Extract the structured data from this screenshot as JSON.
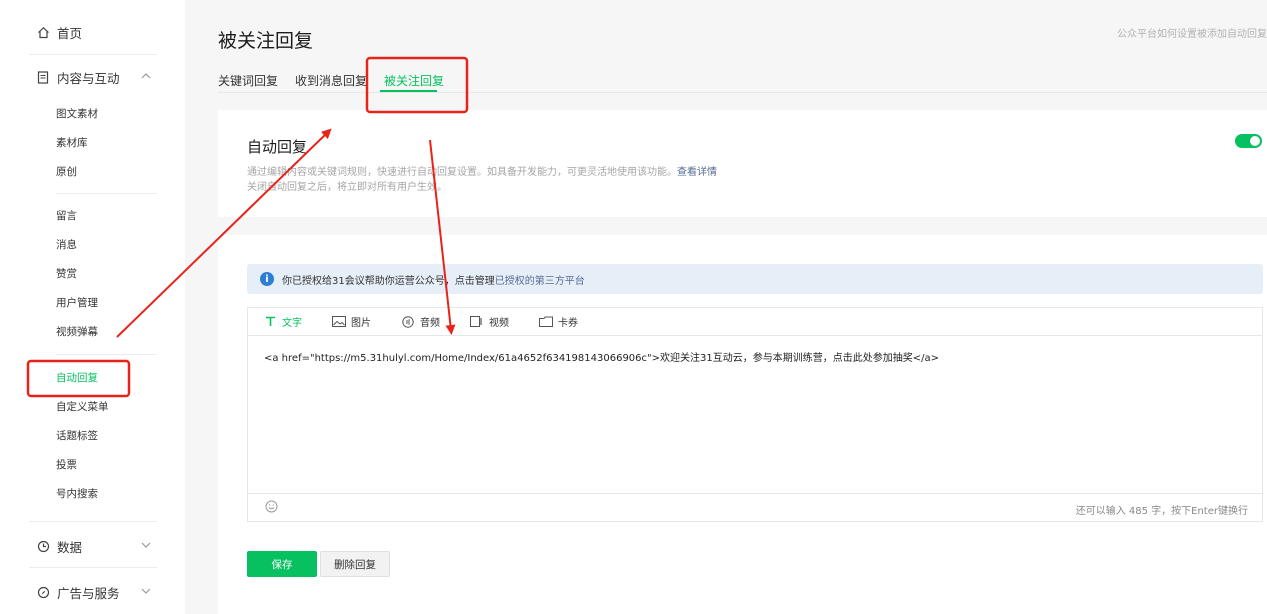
{
  "sidebar": {
    "home": "首页",
    "content_group": "内容与互动",
    "content_items": [
      "图文素材",
      "素材库",
      "原创"
    ],
    "interact_items": [
      "留言",
      "消息",
      "赞赏",
      "用户管理",
      "视频弹幕"
    ],
    "reply_items": [
      "自动回复",
      "自定义菜单",
      "话题标签",
      "投票",
      "号内搜索"
    ],
    "data_group": "数据",
    "ads_group": "广告与服务"
  },
  "header": {
    "title": "被关注回复",
    "help_link": "公众平台如何设置被添加自动回复"
  },
  "tabs": [
    {
      "label": "关键词回复"
    },
    {
      "label": "收到消息回复"
    },
    {
      "label": "被关注回复"
    }
  ],
  "auto_reply": {
    "title": "自动回复",
    "desc_line1": "通过编辑内容或关键词规则，快速进行自动回复设置。如具备开发能力，可更灵活地使用该功能。",
    "desc_link": "查看详情",
    "desc_line2": "关闭自动回复之后，将立即对所有用户生效。",
    "enabled": true
  },
  "notice": {
    "text": "你已授权给31会议帮助你运营公众号，点击管理",
    "link": "已授权的第三方平台"
  },
  "editor": {
    "types": [
      {
        "label": "文字",
        "icon": "text-icon"
      },
      {
        "label": "图片",
        "icon": "image-icon"
      },
      {
        "label": "音频",
        "icon": "audio-icon"
      },
      {
        "label": "视频",
        "icon": "video-icon"
      },
      {
        "label": "卡券",
        "icon": "card-icon"
      }
    ],
    "content": "<a href=\"https://m5.31hulyl.com/Home/Index/61a4652f634198143066906c\">欢迎关注31互动云，参与本期训练营，点击此处参加抽奖</a>",
    "counter": "还可以输入 485 字，按下Enter键换行"
  },
  "actions": {
    "save": "保存",
    "delete": "删除回复"
  },
  "colors": {
    "accent": "#07c160",
    "annotation": "#e8231a",
    "link": "#576b95"
  }
}
